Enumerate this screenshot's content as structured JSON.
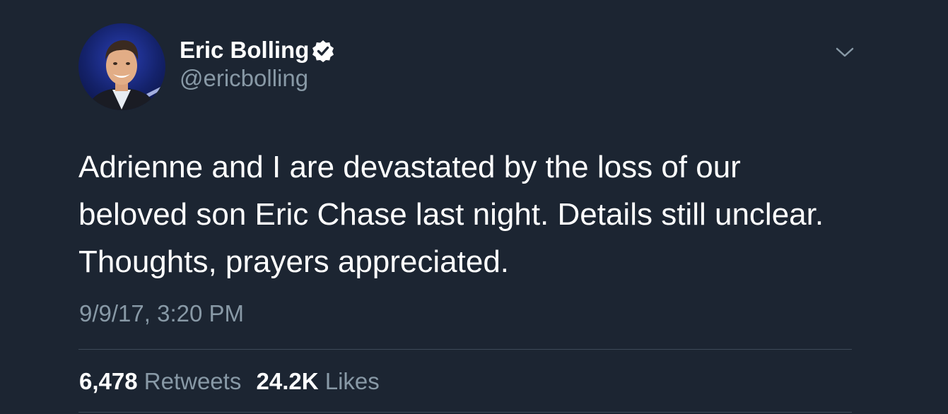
{
  "author": {
    "display_name": "Eric Bolling",
    "handle": "@ericbolling",
    "verified": true
  },
  "tweet": {
    "text_lines": [
      "Adrienne and I are devastated by the loss of our",
      "beloved son Eric Chase last night. Details still unclear.",
      "Thoughts, prayers appreciated."
    ],
    "timestamp": "9/9/17, 3:20 PM"
  },
  "stats": {
    "retweets_count": "6,478",
    "retweets_label": "Retweets",
    "likes_count": "24.2K",
    "likes_label": "Likes"
  },
  "colors": {
    "background": "#1c2532",
    "primary_text": "#ffffff",
    "secondary_text": "#8899a6",
    "divider": "#3d4a58"
  },
  "icons": {
    "verified": "verified-badge-icon",
    "menu": "chevron-down-icon"
  }
}
